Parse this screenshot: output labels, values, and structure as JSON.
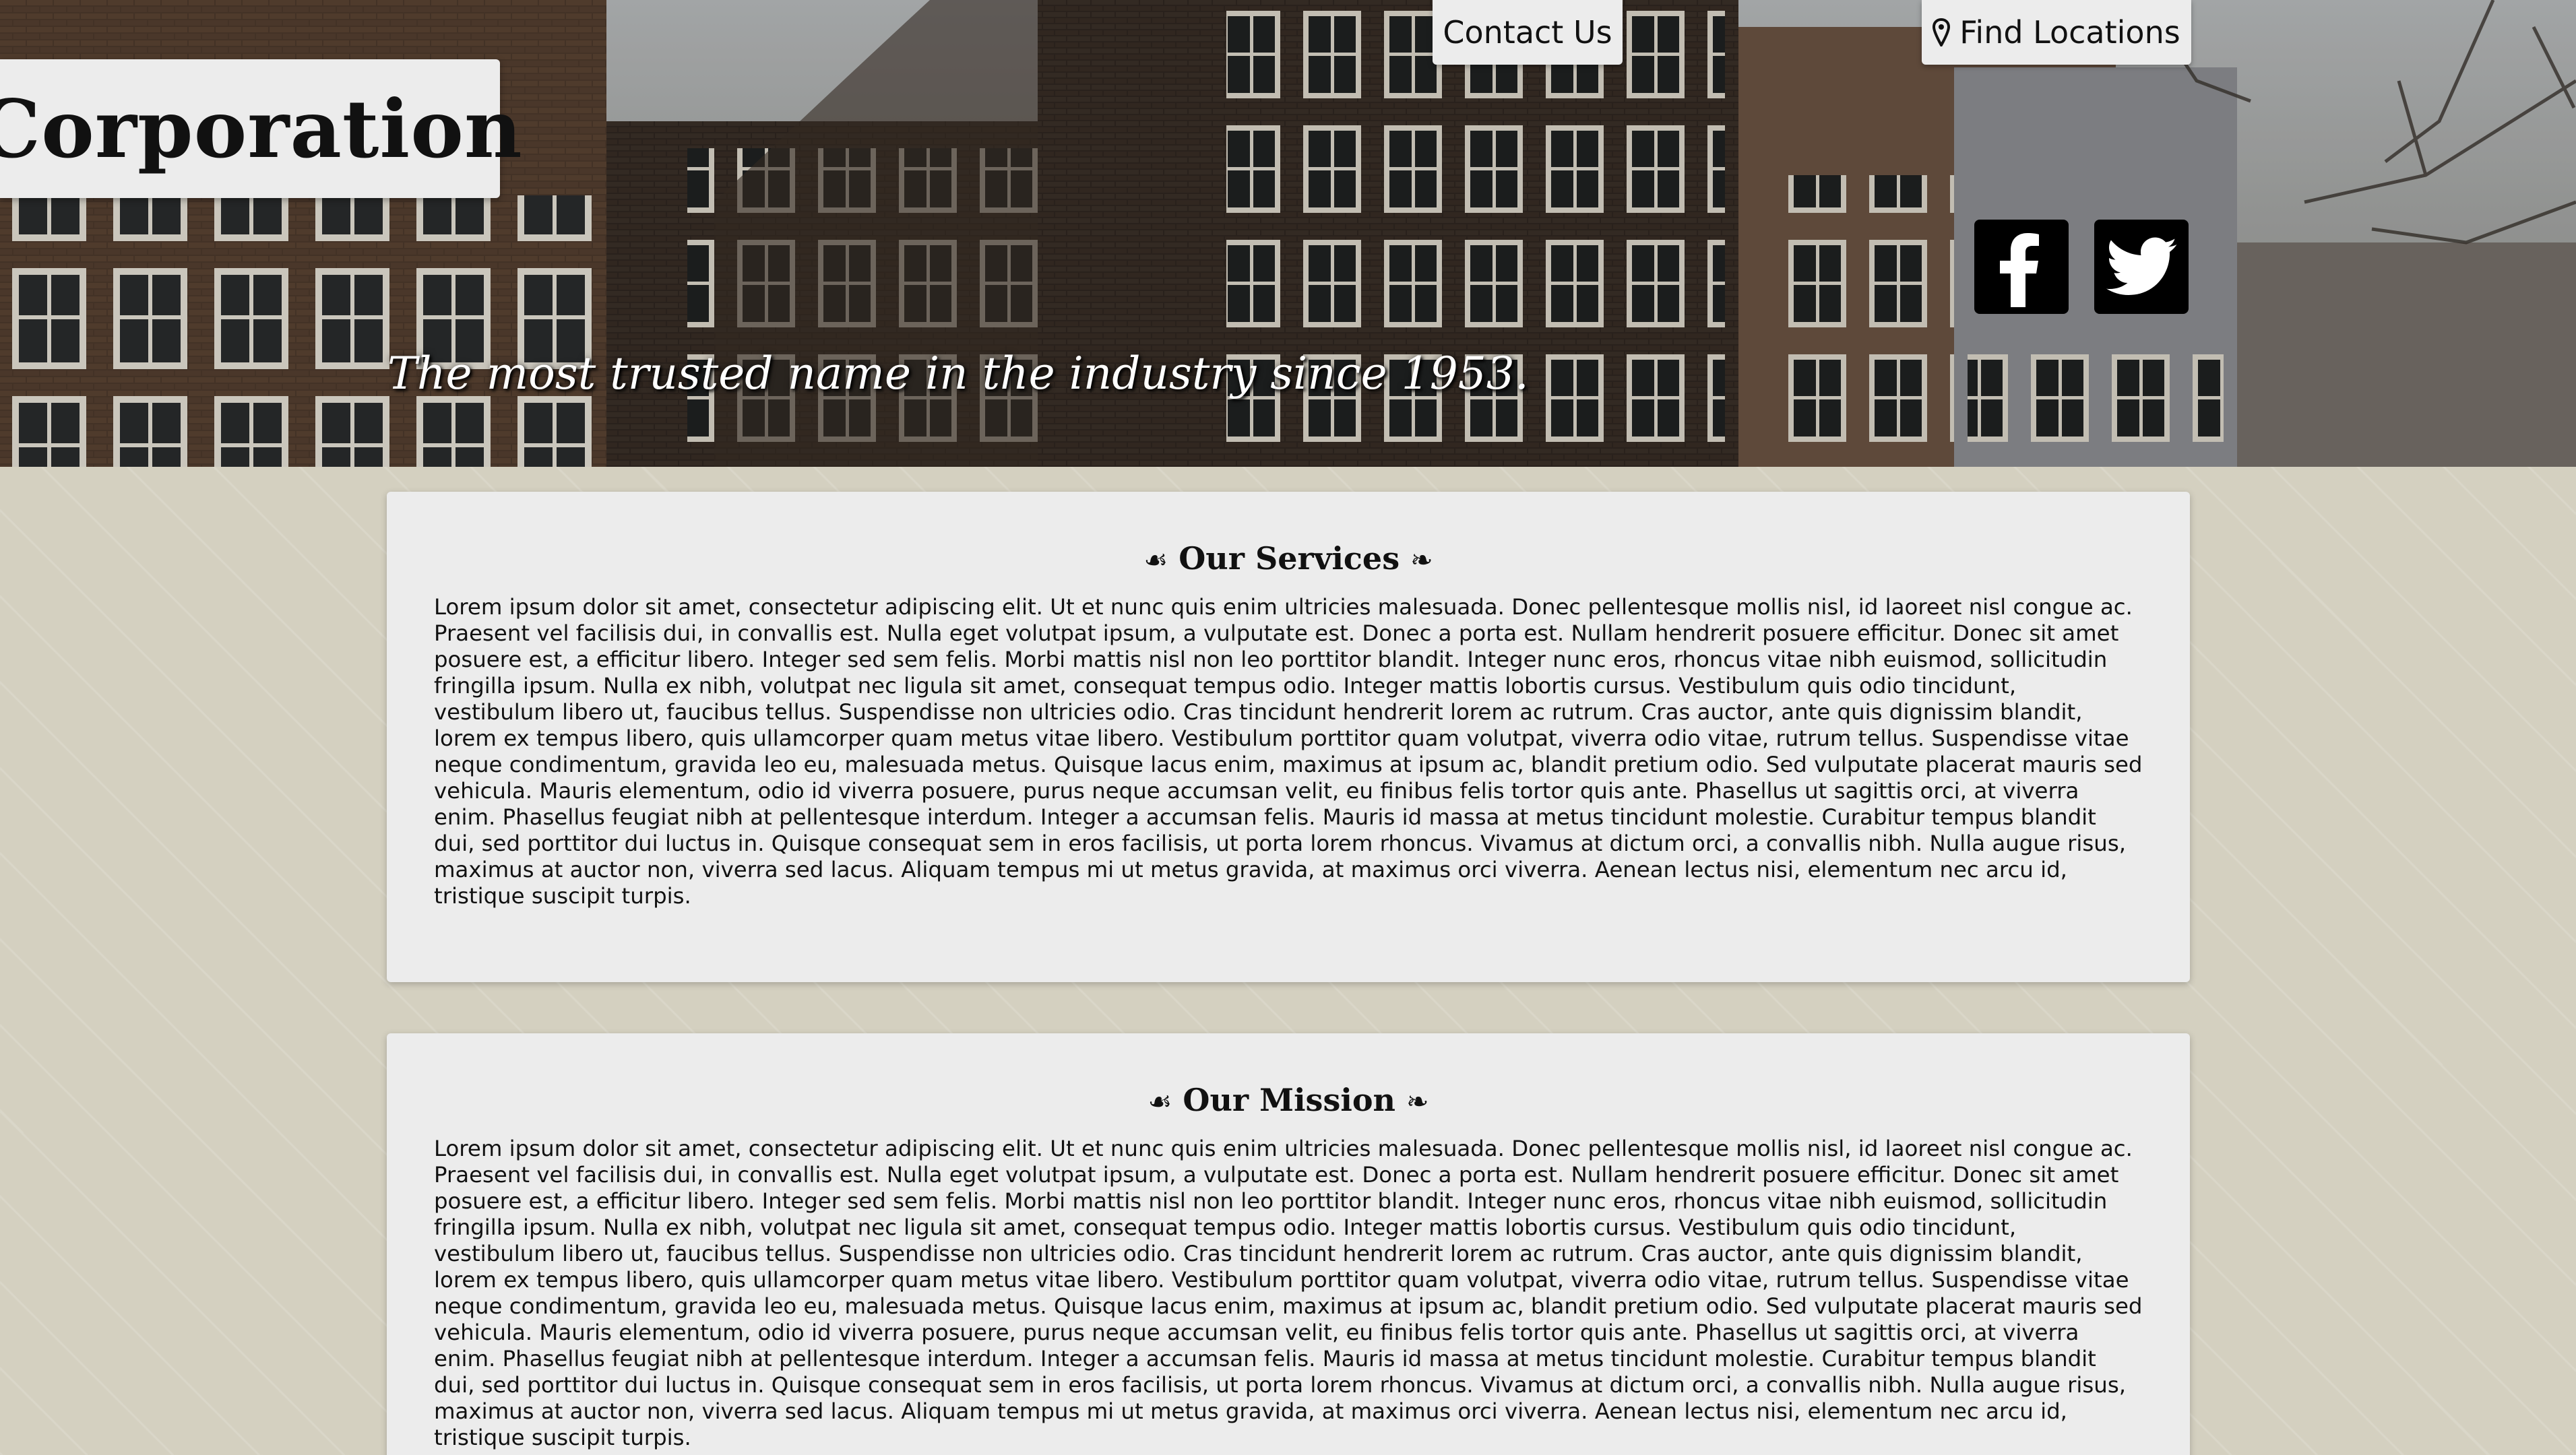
{
  "header": {
    "logo_text": "Corporation",
    "tagline": "The most trusted name in the industry since 1953.",
    "nav": {
      "contact_label": "Contact Us",
      "find_label": "Find Locations"
    },
    "social": {
      "facebook_icon": "facebook-icon",
      "twitter_icon": "twitter-icon"
    }
  },
  "sections": [
    {
      "heading_ornament_left": "☙",
      "heading": "Our Services",
      "heading_ornament_right": "❧",
      "body": "Lorem ipsum dolor sit amet, consectetur adipiscing elit. Ut et nunc quis enim ultricies malesuada. Donec pellentesque mollis nisl, id laoreet nisl congue ac. Praesent vel facilisis dui, in convallis est. Nulla eget volutpat ipsum, a vulputate est. Donec a porta est. Nullam hendrerit posuere efficitur. Donec sit amet posuere est, a efficitur libero. Integer sed sem felis. Morbi mattis nisl non leo porttitor blandit. Integer nunc eros, rhoncus vitae nibh euismod, sollicitudin fringilla ipsum. Nulla ex nibh, volutpat nec ligula sit amet, consequat tempus odio. Integer mattis lobortis cursus. Vestibulum quis odio tincidunt, vestibulum libero ut, faucibus tellus. Suspendisse non ultricies odio. Cras tincidunt hendrerit lorem ac rutrum. Cras auctor, ante quis dignissim blandit, lorem ex tempus libero, quis ullamcorper quam metus vitae libero. Vestibulum porttitor quam volutpat, viverra odio vitae, rutrum tellus. Suspendisse vitae neque condimentum, gravida leo eu, malesuada metus. Quisque lacus enim, maximus at ipsum ac, blandit pretium odio. Sed vulputate placerat mauris sed vehicula. Mauris elementum, odio id viverra posuere, purus neque accumsan velit, eu finibus felis tortor quis ante. Phasellus ut sagittis orci, at viverra enim. Phasellus feugiat nibh at pellentesque interdum. Integer a accumsan felis. Mauris id massa at metus tincidunt molestie. Curabitur tempus blandit dui, sed porttitor dui luctus in. Quisque consequat sem in eros facilisis, ut porta lorem rhoncus. Vivamus at dictum orci, a convallis nibh. Nulla augue risus, maximus at auctor non, viverra sed lacus. Aliquam tempus mi ut metus gravida, at maximus orci viverra. Aenean lectus nisi, elementum nec arcu id, tristique suscipit turpis."
    },
    {
      "heading_ornament_left": "☙",
      "heading": "Our Mission",
      "heading_ornament_right": "❧",
      "body": "Lorem ipsum dolor sit amet, consectetur adipiscing elit. Ut et nunc quis enim ultricies malesuada. Donec pellentesque mollis nisl, id laoreet nisl congue ac. Praesent vel facilisis dui, in convallis est. Nulla eget volutpat ipsum, a vulputate est. Donec a porta est. Nullam hendrerit posuere efficitur. Donec sit amet posuere est, a efficitur libero. Integer sed sem felis. Morbi mattis nisl non leo porttitor blandit. Integer nunc eros, rhoncus vitae nibh euismod, sollicitudin fringilla ipsum. Nulla ex nibh, volutpat nec ligula sit amet, consequat tempus odio. Integer mattis lobortis cursus. Vestibulum quis odio tincidunt, vestibulum libero ut, faucibus tellus. Suspendisse non ultricies odio. Cras tincidunt hendrerit lorem ac rutrum. Cras auctor, ante quis dignissim blandit, lorem ex tempus libero, quis ullamcorper quam metus vitae libero. Vestibulum porttitor quam volutpat, viverra odio vitae, rutrum tellus. Suspendisse vitae neque condimentum, gravida leo eu, malesuada metus. Quisque lacus enim, maximus at ipsum ac, blandit pretium odio. Sed vulputate placerat mauris sed vehicula. Mauris elementum, odio id viverra posuere, purus neque accumsan velit, eu finibus felis tortor quis ante. Phasellus ut sagittis orci, at viverra enim. Phasellus feugiat nibh at pellentesque interdum. Integer a accumsan felis. Mauris id massa at metus tincidunt molestie. Curabitur tempus blandit dui, sed porttitor dui luctus in. Quisque consequat sem in eros facilisis, ut porta lorem rhoncus. Vivamus at dictum orci, a convallis nibh. Nulla augue risus, maximus at auctor non, viverra sed lacus. Aliquam tempus mi ut metus gravida, at maximus orci viverra. Aenean lectus nisi, elementum nec arcu id, tristique suscipit turpis."
    }
  ]
}
